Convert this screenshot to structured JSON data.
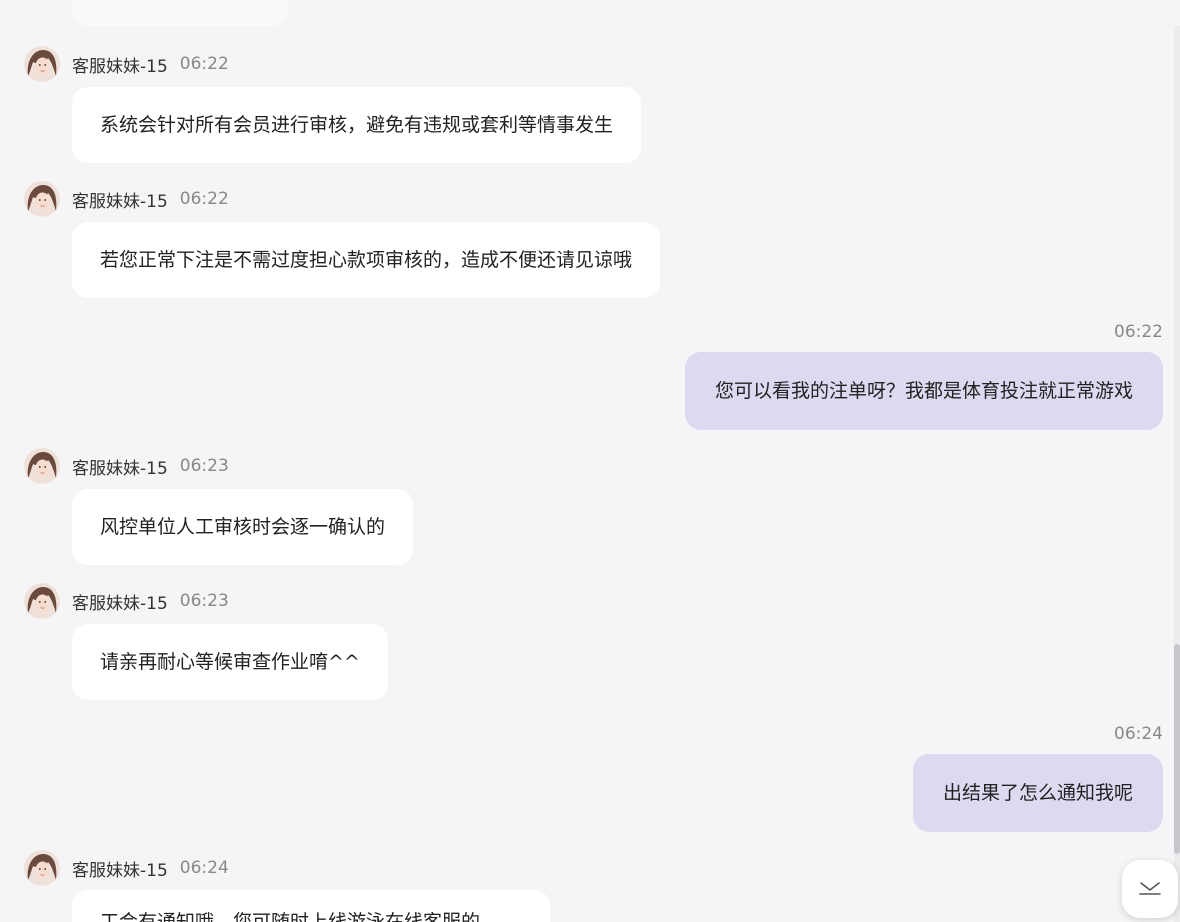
{
  "partial_last_message_text": "工会有通知哦，您可随时上线游泳在线客服的",
  "messages": [
    {
      "direction": "in",
      "sender": "客服妹妹-15",
      "time": "06:22",
      "text": "系统会针对所有会员进行审核，避免有违规或套利等情事发生"
    },
    {
      "direction": "in",
      "sender": "客服妹妹-15",
      "time": "06:22",
      "text": "若您正常下注是不需过度担心款项审核的，造成不便还请见谅哦"
    },
    {
      "direction": "out",
      "time": "06:22",
      "text": "您可以看我的注单呀？我都是体育投注就正常游戏"
    },
    {
      "direction": "in",
      "sender": "客服妹妹-15",
      "time": "06:23",
      "text": "风控单位人工审核时会逐一确认的"
    },
    {
      "direction": "in",
      "sender": "客服妹妹-15",
      "time": "06:23",
      "text": "请亲再耐心等候审查作业唷^^"
    },
    {
      "direction": "out",
      "time": "06:24",
      "text": "出结果了怎么通知我呢"
    },
    {
      "direction": "in",
      "sender": "客服妹妹-15",
      "time": "06:24",
      "text": ""
    }
  ],
  "icons": {
    "avatar": "agent-avatar-icon",
    "scroll_down": "chevron-down-icon"
  },
  "colors": {
    "background": "#f5f5f7",
    "incoming_bubble": "#ffffff",
    "outgoing_bubble": "#dcdaf1",
    "time_text": "#888888"
  }
}
